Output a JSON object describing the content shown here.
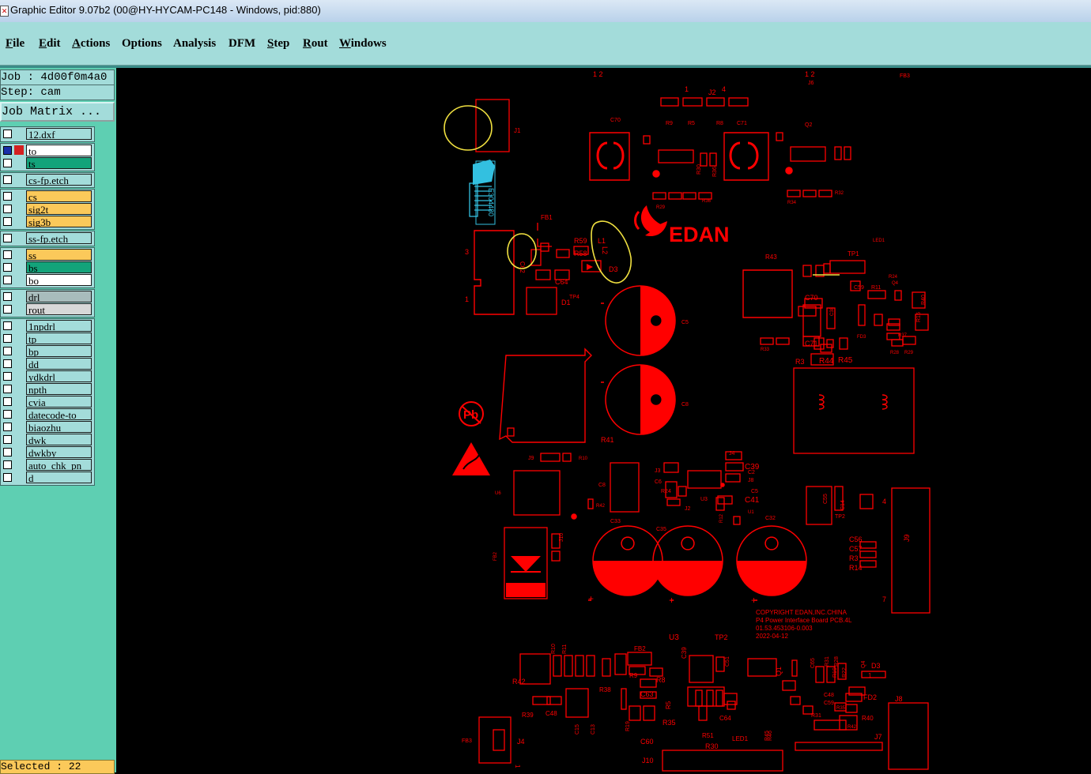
{
  "window": {
    "title": "Graphic Editor 9.07b2 (00@HY-HYCAM-PC148 - Windows, pid:880)"
  },
  "menu": [
    "File",
    "Edit",
    "Actions",
    "Options",
    "Analysis",
    "DFM",
    "Step",
    "Rout",
    "Windows"
  ],
  "job": {
    "job_line": "Job : 4d00f0m4a0",
    "step_line": "Step: cam",
    "matrix_button": "Job Matrix ..."
  },
  "layers": [
    {
      "name": "12.dxf",
      "color": "aqua",
      "group": 1
    },
    {
      "name": "to",
      "color": "white",
      "group": 2,
      "selected": true,
      "flag": "red"
    },
    {
      "name": "ts",
      "color": "green",
      "group": 2
    },
    {
      "name": "cs-fp.etch",
      "color": "aqua",
      "group": 3
    },
    {
      "name": "cs",
      "color": "orange",
      "group": 4
    },
    {
      "name": "sig2t",
      "color": "orange",
      "group": 4
    },
    {
      "name": "sig3b",
      "color": "orange",
      "group": 4
    },
    {
      "name": "ss-fp.etch",
      "color": "aqua",
      "group": 5
    },
    {
      "name": "ss",
      "color": "orange",
      "group": 6
    },
    {
      "name": "bs",
      "color": "green",
      "group": 6
    },
    {
      "name": "bo",
      "color": "white",
      "group": 6
    },
    {
      "name": "drl",
      "color": "grey",
      "group": 7
    },
    {
      "name": "rout",
      "color": "lgrey",
      "group": 7
    },
    {
      "name": "1npdrl",
      "color": "aqua",
      "group": 8
    },
    {
      "name": "tp",
      "color": "aqua",
      "group": 8
    },
    {
      "name": "bp",
      "color": "aqua",
      "group": 8
    },
    {
      "name": "dd",
      "color": "aqua",
      "group": 8
    },
    {
      "name": "ydkdrl",
      "color": "aqua",
      "group": 8
    },
    {
      "name": "npth",
      "color": "aqua",
      "group": 8
    },
    {
      "name": "cvia",
      "color": "aqua",
      "group": 8
    },
    {
      "name": "datecode-to",
      "color": "aqua",
      "group": 8
    },
    {
      "name": "biaozhu",
      "color": "aqua",
      "group": 8
    },
    {
      "name": "dwk",
      "color": "aqua",
      "group": 8
    },
    {
      "name": "dwkby",
      "color": "aqua",
      "group": 8
    },
    {
      "name": "auto_chk_pn",
      "color": "aqua",
      "group": 8
    },
    {
      "name": "d",
      "color": "aqua",
      "group": 8
    }
  ],
  "status": {
    "selected": "Selected : 22"
  },
  "pcb": {
    "logo": "EDAN",
    "copyright_lines": [
      "COPYRIGHT EDAN,INC.CHINA",
      "P4 Power Interface Board PCB.4L",
      "01.53.453106-0.003",
      "2022-04-12"
    ],
    "refdes": [
      "J1",
      "J2",
      "J3",
      "J4",
      "J5",
      "J6",
      "J7",
      "J8",
      "J9",
      "J10",
      "C2",
      "C5",
      "C6",
      "C7",
      "C8",
      "C32",
      "C33",
      "C35",
      "C36",
      "C37",
      "C38",
      "C46",
      "C47",
      "C48",
      "C59",
      "C60",
      "C62",
      "C63",
      "C64",
      "C65",
      "C70",
      "C71",
      "R3",
      "R5",
      "R8",
      "R9",
      "R10",
      "R11",
      "R12",
      "R14",
      "R15",
      "R19",
      "R22",
      "R24",
      "R27",
      "R28",
      "R29",
      "R30",
      "R31",
      "R32",
      "R33",
      "R34",
      "R35",
      "R36",
      "R37",
      "R38",
      "R39",
      "R40",
      "R41",
      "R42",
      "R43",
      "R44",
      "R45",
      "R46",
      "R51",
      "R52",
      "R58",
      "R59",
      "L1",
      "L2",
      "L3",
      "L4",
      "U1",
      "U2",
      "U3",
      "U5",
      "U6",
      "U7",
      "Q1",
      "Q2",
      "Q4",
      "D1",
      "D2",
      "D3",
      "FB1",
      "FB2",
      "FB3",
      "FD2",
      "FD3",
      "TP1",
      "TP2",
      "TP3",
      "TP4",
      "LED1",
      "X1",
      "C14",
      "C15",
      "C13",
      "C51",
      "C52",
      "C39",
      "C41",
      "C55",
      "C56",
      "C57",
      "C58",
      "C61"
    ],
    "pin_labels": [
      "1 2",
      "1 2",
      "1",
      "4",
      "3",
      "1",
      "4",
      "1",
      "7",
      "1"
    ],
    "rot_text": "E304480"
  },
  "colors": {
    "board": "#ff0000",
    "highlight": "#f0e040",
    "silk": "#33c0e0"
  }
}
